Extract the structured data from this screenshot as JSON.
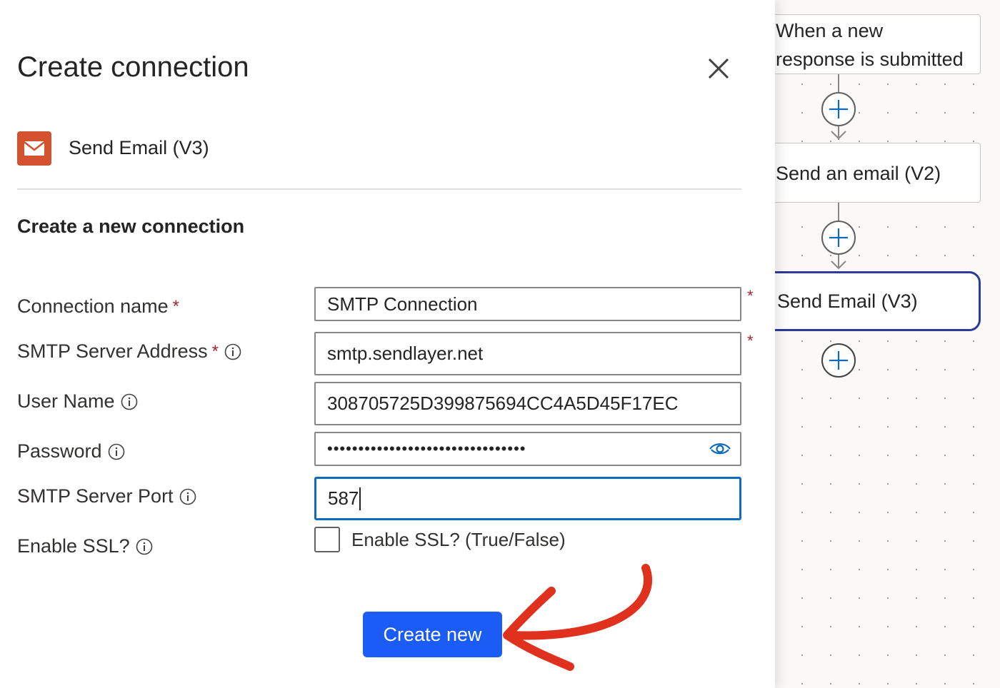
{
  "dialog": {
    "title": "Create connection",
    "connector_name": "Send Email (V3)",
    "section_heading": "Create a new connection",
    "required_marker": "*",
    "fields": [
      {
        "label": "Connection name",
        "required": true,
        "info": false,
        "value": "SMTP Connection"
      },
      {
        "label": "SMTP Server Address",
        "required": true,
        "info": true,
        "value": "smtp.sendlayer.net"
      },
      {
        "label": "User Name",
        "required": false,
        "info": true,
        "value": "308705725D399875694CC4A5D45F17EC"
      },
      {
        "label": "Password",
        "required": false,
        "info": true,
        "value": "••••••••••••••••••••••••••••••••"
      },
      {
        "label": "SMTP Server Port",
        "required": false,
        "info": true,
        "value": "587"
      },
      {
        "label": "Enable SSL?",
        "required": false,
        "info": true
      }
    ],
    "ssl_checkbox_label": "Enable SSL? (True/False)",
    "ssl_checked": false,
    "create_button": "Create new"
  },
  "flow": {
    "steps": [
      {
        "title": "When a new response is submitted",
        "line1": "When a new",
        "line2": "response is submitted"
      },
      {
        "title": "Send an email (V2)"
      },
      {
        "title": "Send Email (V3)",
        "selected": true
      }
    ]
  },
  "colors": {
    "accent": "#1a5cf5",
    "focus": "#0f6cbd",
    "connector_icon": "#d35230",
    "annotation_arrow": "#e0301e",
    "selected_step_border": "#2b3b9e"
  },
  "icons": [
    "close-icon",
    "email-icon",
    "info-icon",
    "eye-icon",
    "plus-icon",
    "curved-arrow"
  ]
}
